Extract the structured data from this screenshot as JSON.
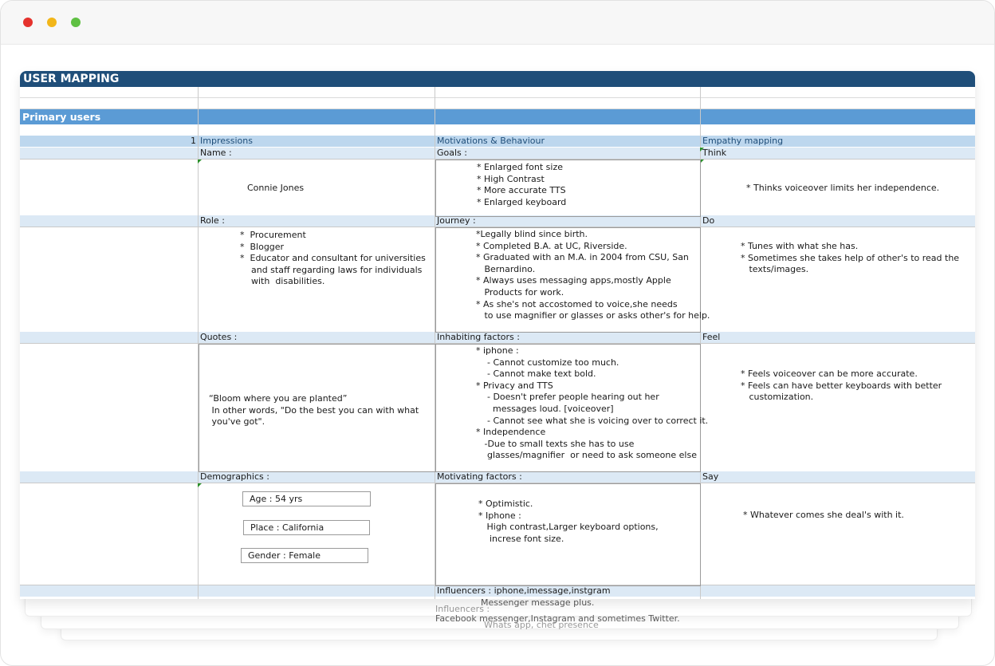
{
  "window": {
    "controls": [
      "close",
      "minimize",
      "maximize"
    ]
  },
  "sheet": {
    "title": "USER MAPPING",
    "section": "Primary users",
    "row_number": "1",
    "columns": [
      "Impressions",
      "Motivations & Behaviour",
      "Empathy mapping"
    ],
    "labels": {
      "name": "Name :",
      "goals": "Goals :",
      "think": "Think",
      "role": "Role :",
      "journey": "Journey :",
      "do": "Do",
      "quotes": "Quotes :",
      "inhabiting": "Inhabiting factors :",
      "feel": "Feel",
      "demographics": "Demographics :",
      "motivating": "Motivating factors :",
      "say": "Say"
    },
    "name_value": "Connie Jones",
    "goals": [
      "* Enlarged font size",
      "* High Contrast",
      "* More accurate TTS",
      "* Enlarged keyboard"
    ],
    "think": "* Thinks voiceover limits her independence.",
    "role": [
      "*  Procurement",
      "*  Blogger",
      "*  Educator and consultant for universities",
      "    and staff regarding laws for individuals",
      "    with  disabilities."
    ],
    "journey": [
      "*Legally blind since birth.",
      "* Completed B.A. at UC, Riverside.",
      "* Graduated with an M.A. in 2004 from CSU, San",
      "   Bernardino.",
      "* Always uses messaging apps,mostly Apple",
      "   Products for work.",
      "* As she's not accostomed to voice,she needs",
      "   to use magnifier or glasses or asks other's for help."
    ],
    "do": [
      "* Tunes with what she has.",
      "* Sometimes she takes help of other's to read the",
      "   texts/images."
    ],
    "quotes": [
      "“Bloom where you are planted”",
      " In other words, \"Do the best you can with what",
      " you've got\"."
    ],
    "inhabiting": [
      "* iphone :",
      "    - Cannot customize too much.",
      "    - Cannot make text bold.",
      "* Privacy and TTS",
      "    - Doesn't prefer people hearing out her",
      "      messages loud. [voiceover]",
      "    - Cannot see what she is voicing over to correct it.",
      "* Independence",
      "   -Due to small texts she has to use",
      "    glasses/magnifier  or need to ask someone else"
    ],
    "feel": [
      "* Feels voiceover can be more accurate.",
      "* Feels can have better keyboards with better",
      "   customization."
    ],
    "demographics": {
      "age": "Age : 54 yrs",
      "place": "Place : California",
      "gender": "Gender : Female"
    },
    "motivating": [
      "* Optimistic.",
      "* Iphone :",
      "   High contrast,Larger keyboard options,",
      "    increse font size."
    ],
    "say": "*    Whatever comes she deal's with it.",
    "influencers": "Influencers : iphone,imessage,instgram",
    "ghost_lines": [
      "Messenger message plus.",
      "Influencers :",
      "Facebook messenger,Instagram and sometimes Twitter.",
      "Whats app, chet presence"
    ]
  },
  "colors": {
    "title_bar": "#1f4e79",
    "section_bar": "#5b9bd5",
    "header_band": "#bdd7ee",
    "label_band": "#dce9f5"
  }
}
